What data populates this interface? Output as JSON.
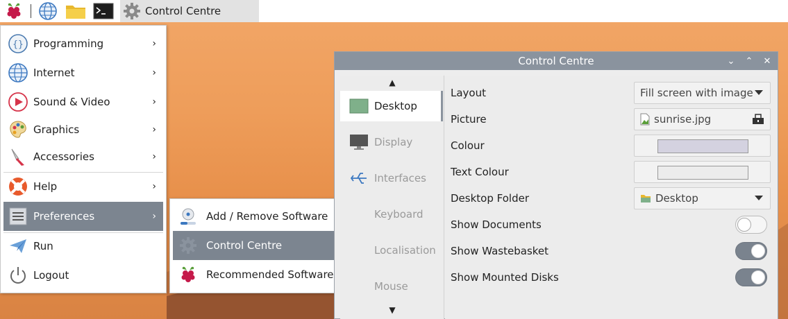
{
  "taskbar": {
    "task_label": "Control Centre",
    "icons": [
      "raspberry-icon",
      "globe-icon",
      "folder-icon",
      "terminal-icon",
      "gear-icon"
    ]
  },
  "main_menu": {
    "items": [
      {
        "label": "Programming",
        "icon": "braces-icon"
      },
      {
        "label": "Internet",
        "icon": "globe-icon"
      },
      {
        "label": "Sound & Video",
        "icon": "play-icon"
      },
      {
        "label": "Graphics",
        "icon": "palette-icon"
      },
      {
        "label": "Accessories",
        "icon": "knife-icon"
      },
      {
        "label": "Help",
        "icon": "lifebuoy-icon"
      },
      {
        "label": "Preferences",
        "icon": "sliders-icon"
      },
      {
        "label": "Run",
        "icon": "paper-plane-icon"
      },
      {
        "label": "Logout",
        "icon": "power-icon"
      }
    ],
    "chevron": "›"
  },
  "sub_menu": {
    "items": [
      {
        "label": "Add / Remove Software",
        "icon": "package-icon"
      },
      {
        "label": "Control Centre",
        "icon": "gear-icon"
      },
      {
        "label": "Recommended Software",
        "icon": "raspberry-icon"
      }
    ]
  },
  "window": {
    "title": "Control Centre",
    "controls": {
      "minimize": "⌄",
      "maximize": "⌃",
      "close": "✕"
    },
    "sidebar": {
      "up": "▲",
      "down": "▼",
      "items": [
        "Desktop",
        "Display",
        "Interfaces",
        "Keyboard",
        "Localisation",
        "Mouse"
      ]
    },
    "settings": {
      "layout": {
        "label": "Layout",
        "value": "Fill screen with image"
      },
      "picture": {
        "label": "Picture",
        "value": "sunrise.jpg"
      },
      "colour": {
        "label": "Colour",
        "swatch": "#d4d2e0"
      },
      "text_colour": {
        "label": "Text Colour",
        "swatch": "#ececec"
      },
      "desktop_folder": {
        "label": "Desktop Folder",
        "value": "Desktop"
      },
      "show_documents": {
        "label": "Show Documents",
        "on": false
      },
      "show_wastebasket": {
        "label": "Show Wastebasket",
        "on": true
      },
      "show_mounted_disks": {
        "label": "Show Mounted Disks",
        "on": true
      }
    }
  }
}
